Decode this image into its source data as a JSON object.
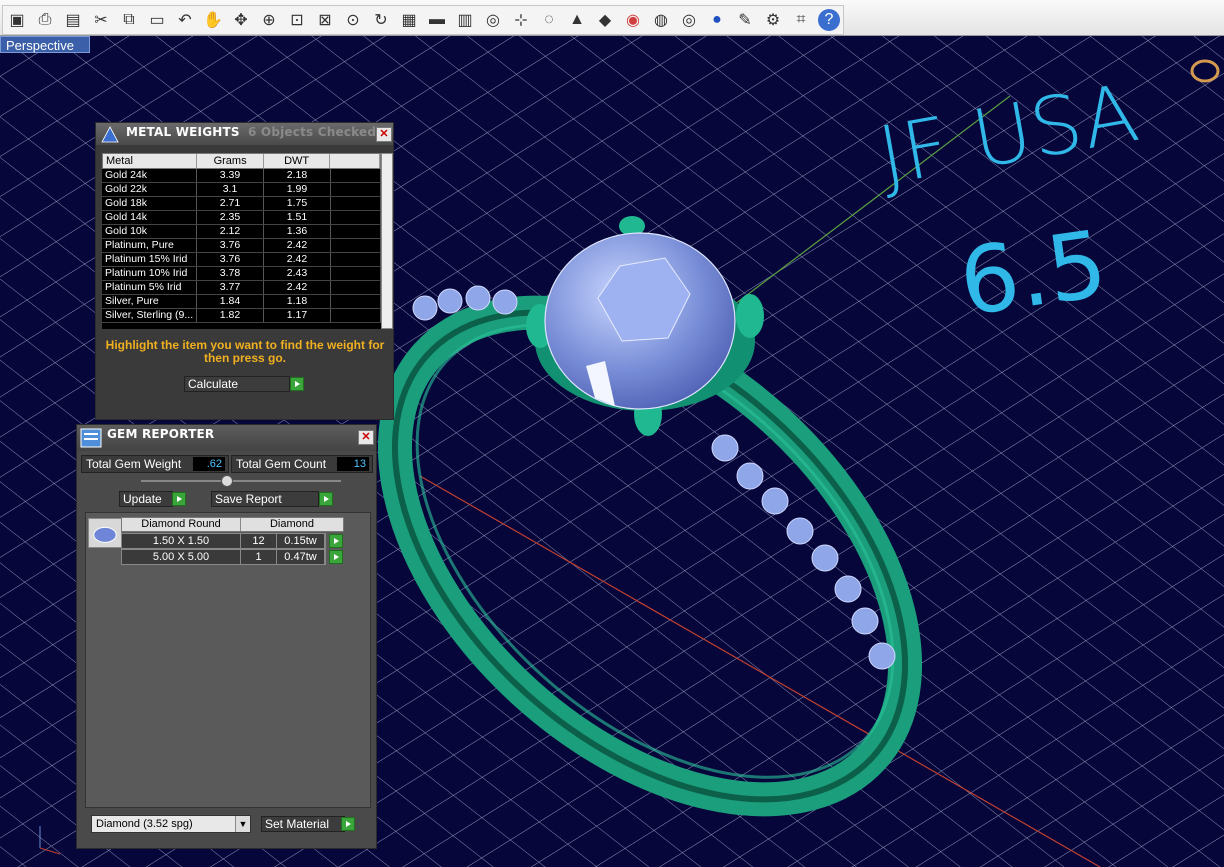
{
  "viewport": {
    "label": "Perspective"
  },
  "annotation": {
    "line1": "JF USA",
    "line2": "6.5"
  },
  "toolbar": {
    "icons": [
      "save-icon",
      "print-icon",
      "new-icon",
      "cut-icon",
      "copy-icon",
      "paste-icon",
      "undo-icon",
      "hand-icon",
      "move-icon",
      "zoom-in-icon",
      "zoom-window-icon",
      "zoom-extents-icon",
      "zoom-dynamic-icon",
      "rotate-view-icon",
      "grid-icon",
      "car-icon",
      "layers-icon",
      "snap-icon",
      "pivot-icon",
      "light-icon",
      "lock-icon",
      "material-icon",
      "color-icon",
      "wireframe-icon",
      "render-grid-icon",
      "sphere-icon",
      "pencil-icon",
      "gear-icon",
      "dimension-icon",
      "help-icon"
    ]
  },
  "metal_weights": {
    "title": "METAL WEIGHTS",
    "status": "6 Objects Checked",
    "columns": [
      "Metal",
      "Grams",
      "DWT"
    ],
    "rows": [
      [
        "Gold 24k",
        "3.39",
        "2.18"
      ],
      [
        "Gold 22k",
        "3.1",
        "1.99"
      ],
      [
        "Gold 18k",
        "2.71",
        "1.75"
      ],
      [
        "Gold 14k",
        "2.35",
        "1.51"
      ],
      [
        "Gold 10k",
        "2.12",
        "1.36"
      ],
      [
        "Platinum, Pure",
        "3.76",
        "2.42"
      ],
      [
        "Platinum 15% Irid",
        "3.76",
        "2.42"
      ],
      [
        "Platinum 10% Irid",
        "3.78",
        "2.43"
      ],
      [
        "Platinum 5% Irid",
        "3.77",
        "2.42"
      ],
      [
        "Silver, Pure",
        "1.84",
        "1.18"
      ],
      [
        "Silver, Sterling (9...",
        "1.82",
        "1.17"
      ]
    ],
    "hint": "Highlight the item you want to find the weight for then press go.",
    "calculate_label": "Calculate"
  },
  "gem_reporter": {
    "title": "GEM REPORTER",
    "total_weight_label": "Total Gem Weight",
    "total_weight": ".62",
    "total_count_label": "Total Gem Count",
    "total_count": "13",
    "update_label": "Update",
    "save_report_label": "Save Report",
    "table_head": [
      "Diamond Round",
      "Diamond"
    ],
    "rows": [
      [
        "1.50 X 1.50",
        "12",
        "0.15tw"
      ],
      [
        "5.00 X 5.00",
        "1",
        "0.47tw"
      ]
    ],
    "material_value": "Diamond    (3.52 spg)",
    "set_material_label": "Set Material"
  }
}
